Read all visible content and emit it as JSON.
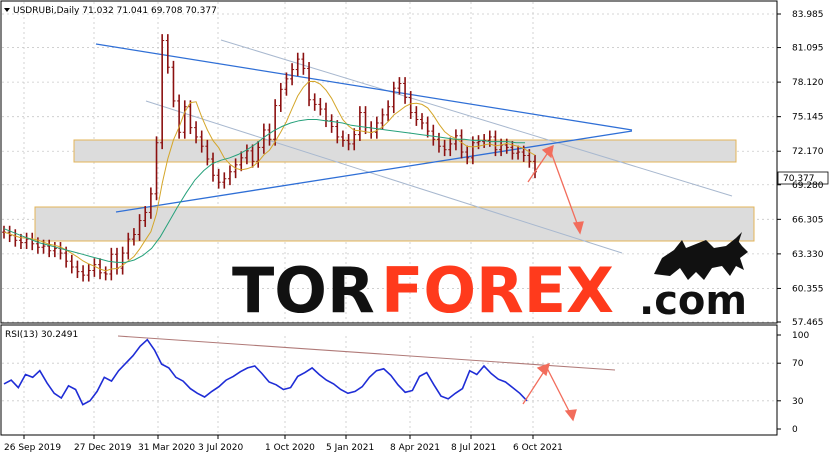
{
  "chart_data": [
    {
      "type": "line",
      "title": "USDRUBi,Daily",
      "ohlc": "71.032 71.041 69.708 70.377",
      "last_price": "70.377",
      "ylim": [
        57.465,
        83.985
      ],
      "y_ticks": [
        "83.985",
        "81.095",
        "78.120",
        "75.145",
        "72.170",
        "69.280",
        "66.305",
        "63.330",
        "60.355",
        "57.465"
      ],
      "x_ticks": [
        "26 Sep 2019",
        "27 Dec 2019",
        "31 Mar 2020",
        "3 Jul 2020",
        "1 Oct 2020",
        "5 Jan 2021",
        "8 Apr 2021",
        "8 Jul 2021",
        "6 Oct 2021"
      ],
      "series": [
        {
          "values": [
            65.2,
            64.9,
            64.5,
            64.3,
            64.6,
            64.2,
            63.9,
            64.0,
            63.6,
            63.8,
            63.4,
            62.7,
            62.2,
            61.8,
            61.5,
            61.9,
            62.4,
            61.7,
            61.6,
            63.3,
            62.1,
            63.4,
            64.6,
            65.0,
            66.2,
            66.9,
            68.5,
            72.9,
            81.7,
            79.4,
            76.5,
            73.8,
            76.0,
            74.2,
            73.4,
            72.6,
            71.5,
            70.1,
            69.5,
            69.8,
            70.4,
            71.0,
            71.6,
            72.2,
            71.3,
            72.5,
            74.0,
            73.2,
            76.1,
            77.5,
            78.4,
            79.2,
            80.1,
            79.3,
            76.6,
            76.2,
            75.8,
            74.8,
            74.3,
            73.4,
            73.1,
            72.8,
            73.6,
            75.5,
            74.2,
            73.8,
            74.6,
            75.3,
            76.0,
            77.6,
            78.0,
            76.8,
            75.5,
            74.9,
            74.6,
            73.9,
            73.2,
            72.6,
            72.3,
            72.8,
            73.5,
            72.1,
            71.6,
            72.9,
            73.0,
            73.1,
            73.4,
            72.3,
            72.7,
            72.5,
            72.0,
            72.1,
            71.8,
            71.3,
            70.4
          ]
        },
        {
          "name": "MA",
          "values": [
            65.5,
            65.2,
            64.9,
            64.6,
            64.3,
            64.1,
            63.9,
            63.7,
            63.5,
            63.3,
            63.1,
            62.9,
            62.7,
            62.6,
            62.6,
            62.8,
            63.2,
            63.8,
            64.8,
            66.1,
            67.4,
            68.6,
            69.7,
            70.5,
            71.1,
            71.4,
            71.6,
            71.9,
            72.3,
            72.8,
            73.4,
            73.9,
            74.3,
            74.6,
            74.8,
            74.9,
            74.9,
            74.8,
            74.7,
            74.6,
            74.4,
            74.3,
            74.2,
            74.1,
            74.0,
            73.9,
            73.8,
            73.7,
            73.6,
            73.5,
            73.4,
            73.3,
            73.2,
            73.2,
            73.1,
            73.1,
            73.0,
            73.0,
            73.0,
            72.9,
            72.9
          ]
        }
      ]
    },
    {
      "type": "line",
      "title": "RSI(13) 30.2491",
      "ylim": [
        0,
        100
      ],
      "y_ticks": [
        "100",
        "70",
        "30",
        "0"
      ],
      "series": [
        {
          "values": [
            48,
            52,
            44,
            58,
            55,
            62,
            49,
            38,
            33,
            46,
            42,
            26,
            30,
            40,
            55,
            51,
            62,
            70,
            78,
            88,
            95,
            84,
            69,
            65,
            55,
            51,
            43,
            38,
            34,
            40,
            45,
            52,
            56,
            61,
            65,
            67,
            59,
            50,
            47,
            42,
            44,
            56,
            60,
            65,
            58,
            52,
            48,
            42,
            38,
            40,
            45,
            55,
            62,
            64,
            57,
            47,
            39,
            41,
            56,
            60,
            47,
            35,
            32,
            38,
            43,
            62,
            58,
            67,
            59,
            53,
            50,
            44,
            38,
            30
          ]
        }
      ]
    }
  ],
  "watermark": {
    "part1": "TOR",
    "part2": "FOREX",
    "part3": ".com"
  },
  "icons": [
    "bull-logo-icon",
    "dropdown-triangle-icon"
  ],
  "colors": {
    "bar": "#8b1010",
    "ma_fast": "#d4a62a",
    "ma_slow": "#26a17b",
    "trendline": "#2f6fd6",
    "channel": "#a8b8cf",
    "forecast": "#f26d5c",
    "rsi": "#1f2dd6",
    "rsi_trend": "#b07a78",
    "zone_fill": "#dcdcdc",
    "zone_border": "#e3b458",
    "watermark_red": "#ff3a1c"
  }
}
